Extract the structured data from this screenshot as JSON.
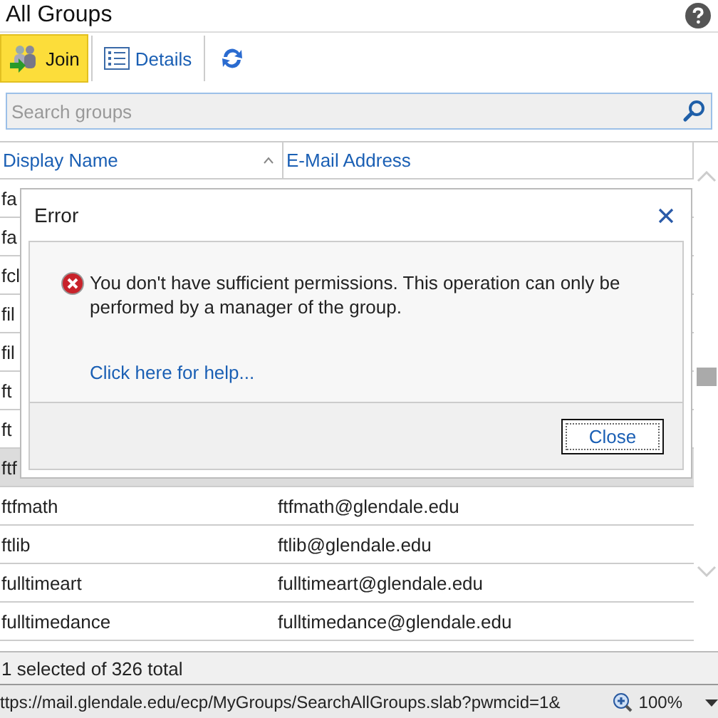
{
  "page": {
    "title": "All Groups"
  },
  "toolbar": [
    {
      "kind": "join",
      "label": "Join",
      "selected": true
    },
    {
      "kind": "details",
      "label": "Details",
      "selected": false
    },
    {
      "kind": "refresh",
      "selected": false
    }
  ],
  "search": {
    "placeholder": "Search groups"
  },
  "table": {
    "columns": [
      {
        "label": "Display Name",
        "sorted": true
      },
      {
        "label": "E-Mail Address",
        "sorted": false
      }
    ],
    "rows": [
      {
        "name": "fa",
        "selected": false
      },
      {
        "name": "fa",
        "selected": false
      },
      {
        "name": "fcl",
        "selected": false
      },
      {
        "name": "fil",
        "selected": false
      },
      {
        "name": "fil",
        "selected": false
      },
      {
        "name": "ft",
        "selected": false
      },
      {
        "name": "ft",
        "selected": false
      },
      {
        "name": "ftf",
        "selected": true
      },
      {
        "name": "ftfmath",
        "email": "ftfmath@glendale.edu",
        "selected": false
      },
      {
        "name": "ftlib",
        "email": "ftlib@glendale.edu",
        "selected": false
      },
      {
        "name": "fulltimeart",
        "email": "fulltimeart@glendale.edu",
        "selected": false
      },
      {
        "name": "fulltimedance",
        "email": "fulltimedance@glendale.edu",
        "selected": false
      }
    ]
  },
  "status_bar": "1 selected of 326 total",
  "dialog": {
    "title": "Error",
    "message": "You don't have sufficient permissions. This operation can only be performed by a manager of the group.",
    "help_link": "Click here for help...",
    "button": "Close"
  },
  "browser_status": {
    "url": "ttps://mail.glendale.edu/ecp/MyGroups/SearchAllGroups.slab?pwmcid=1&",
    "zoom": "100%"
  }
}
